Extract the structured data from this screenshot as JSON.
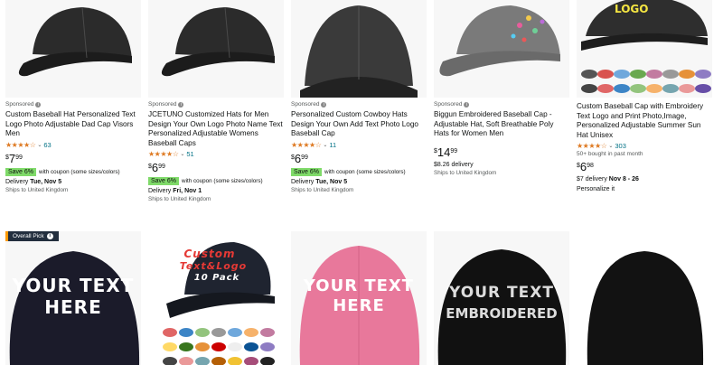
{
  "products_top": [
    {
      "sponsored": "Sponsored",
      "title": "Custom Baseball Hat Personalized Text Logo Photo Adjustable Dad Cap Visors Men",
      "stars": "★★★★☆",
      "reviews": "63",
      "price_cur": "$",
      "price_whole": "7",
      "price_frac": "99",
      "coupon_badge": "Save 6%",
      "coupon_text": "with coupon (some sizes/colors)",
      "delivery_label": "Delivery ",
      "delivery_date": "Tue, Nov 5",
      "ships": "Ships to United Kingdom"
    },
    {
      "sponsored": "Sponsored",
      "title": "JCETUNO Customized Hats for Men Design Your Own Logo Photo Name Text Personalized Adjustable Womens Baseball Caps",
      "stars": "★★★★☆",
      "reviews": "51",
      "price_cur": "$",
      "price_whole": "6",
      "price_frac": "99",
      "coupon_badge": "Save 6%",
      "coupon_text": "with coupon (some sizes/colors)",
      "delivery_label": "Delivery ",
      "delivery_date": "Fri, Nov 1",
      "ships": "Ships to United Kingdom"
    },
    {
      "sponsored": "Sponsored",
      "title": "Personalized Custom Cowboy Hats Design Your Own Add Text Photo Logo Baseball Cap",
      "stars": "★★★★☆",
      "reviews": "11",
      "price_cur": "$",
      "price_whole": "6",
      "price_frac": "99",
      "coupon_badge": "Save 6%",
      "coupon_text": "with coupon (some sizes/colors)",
      "delivery_label": "Delivery ",
      "delivery_date": "Tue, Nov 5",
      "ships": "Ships to United Kingdom"
    },
    {
      "sponsored": "Sponsored",
      "title": "Biggun Embroidered Baseball Cap - Adjustable Hat, Soft Breathable Poly Hats for Women Men",
      "price_cur": "$",
      "price_whole": "14",
      "price_frac": "99",
      "delivery_fee": "$8.26 delivery",
      "ships": "Ships to United Kingdom"
    },
    {
      "title": "Custom Baseball Cap with Embroidery Text Logo and Print Photo,Image, Personalized Adjustable Summer Sun Hat Unisex",
      "stars": "★★★★☆",
      "reviews": "303",
      "bought": "50+ bought in past month",
      "price_cur": "$",
      "price_whole": "6",
      "price_frac": "98",
      "delivery_fee_full": "$7 delivery ",
      "delivery_date": "Nov 8 - 26",
      "personalize": "Personalize it"
    }
  ],
  "overall_pick": "Overall Pick",
  "cap_texts": {
    "c1_line1": "YOUR TEXT",
    "c1_line2": "HERE",
    "c2_line1": "Custom",
    "c2_line2": "Text&Logo",
    "c2_line3": "10 Pack",
    "c3_line1": "YOUR TEXT",
    "c3_line2": "HERE",
    "c4_line1": "YOUR TEXT",
    "c4_line2": "EMBROIDERED",
    "c5_logo": "LOGO"
  },
  "colors": {
    "accent_green": "#7fda69",
    "star": "#de7921",
    "link": "#007185",
    "badge_bg": "#232f3e",
    "badge_accent": "#ff9900"
  }
}
